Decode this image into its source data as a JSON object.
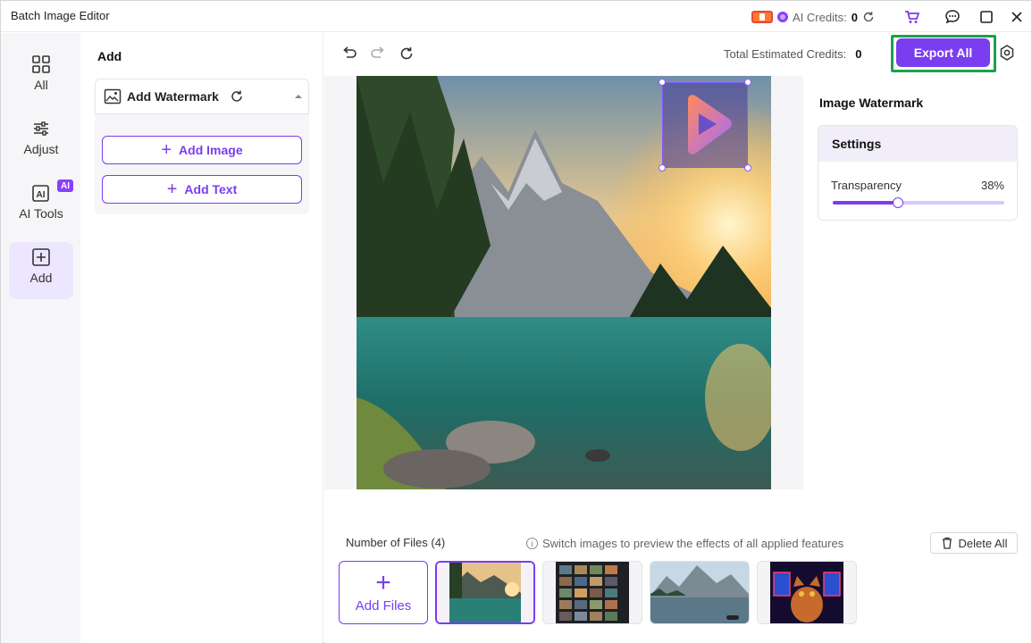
{
  "window": {
    "title": "Batch Image Editor"
  },
  "header": {
    "ai_credits_label": "AI Credits:",
    "ai_credits_value": "0"
  },
  "nav": {
    "items": [
      {
        "label": "All"
      },
      {
        "label": "Adjust"
      },
      {
        "label": "AI Tools",
        "badge": "AI"
      },
      {
        "label": "Add"
      }
    ]
  },
  "add_panel": {
    "title": "Add",
    "watermark_section": "Add Watermark",
    "add_image": "Add Image",
    "add_text": "Add Text"
  },
  "toolbar": {
    "total_credits_label": "Total Estimated Credits:",
    "total_credits_value": "0",
    "export_label": "Export All"
  },
  "settings": {
    "title": "Image Watermark",
    "section": "Settings",
    "transparency_label": "Transparency",
    "transparency_text": "38%",
    "transparency_value": 0.38
  },
  "files": {
    "count_label": "Number of Files (4)",
    "hint": "Switch images to preview the effects of all applied features",
    "delete_all": "Delete All",
    "add_files": "Add Files",
    "thumbnails": [
      {
        "name": "mountain-lake-waterfall",
        "selected": true
      },
      {
        "name": "photo-grid-collage",
        "selected": false
      },
      {
        "name": "mountain-lake-scene",
        "selected": false
      },
      {
        "name": "cat-neon-screens",
        "selected": false
      }
    ]
  },
  "colors": {
    "accent": "#7a3df0",
    "highlight": "#18a34a"
  }
}
